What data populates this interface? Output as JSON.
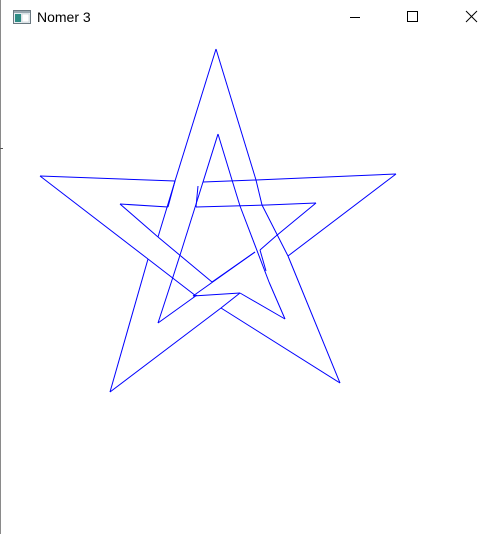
{
  "window": {
    "title": "Nomer 3"
  },
  "titlebar": {
    "app_icon": "application-window-icon",
    "controls": [
      "minimize-icon",
      "maximize-icon",
      "close-icon"
    ]
  },
  "drawing": {
    "shape": "interlaced pentagram outline",
    "stroke_color": "#0000ff",
    "background_color": "#ffffff"
  }
}
